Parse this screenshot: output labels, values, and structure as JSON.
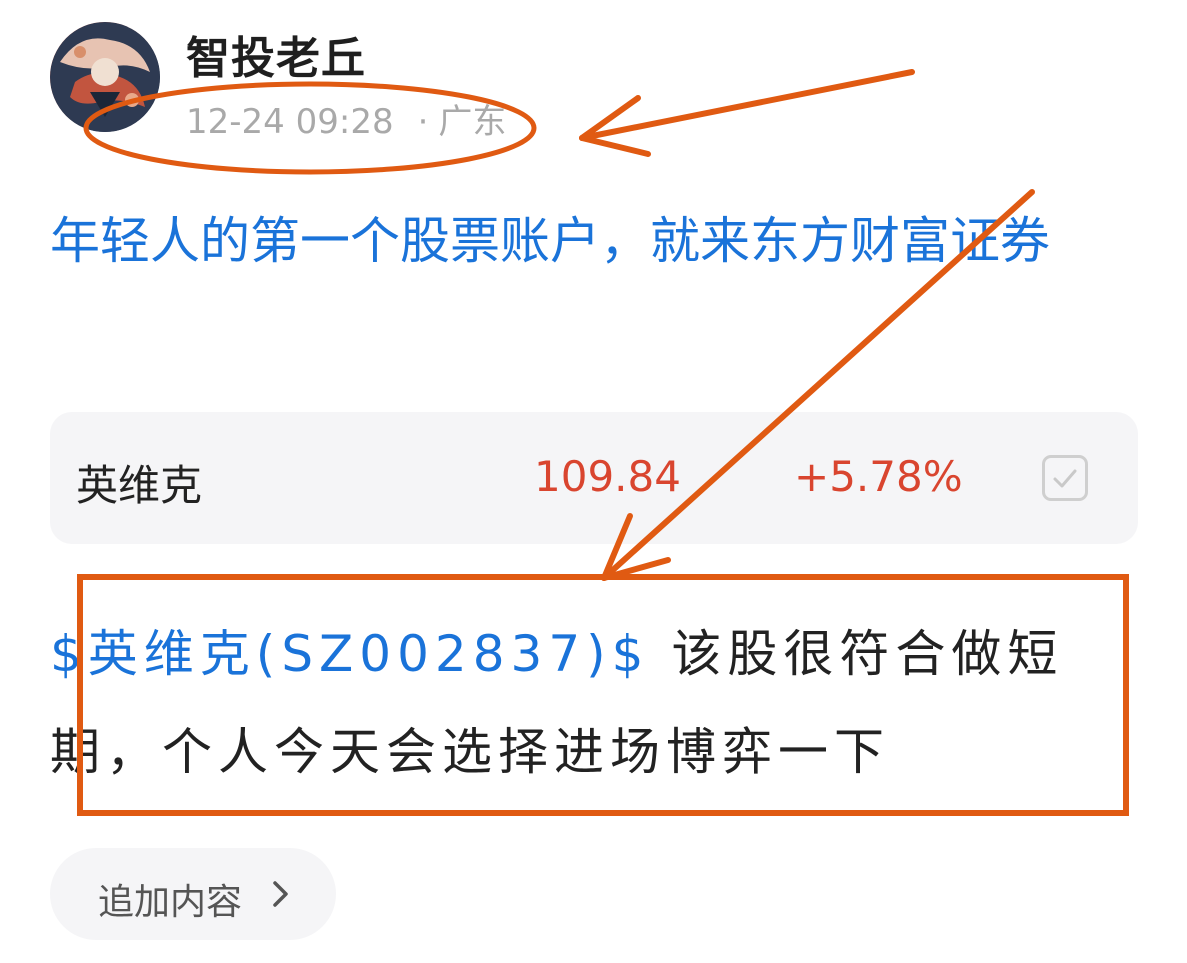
{
  "author": {
    "name": "智投老丘",
    "time": "12-24 09:28",
    "separator": "·",
    "location": "广东"
  },
  "promo": {
    "text": "年轻人的第一个股票账户，就来东方财富证券"
  },
  "stock_card": {
    "name": "英维克",
    "price": "109.84",
    "change": "+5.78%"
  },
  "post": {
    "ticker": "$英维克(SZ002837)$",
    "body": " 该股很符合做短期，个人今天会选择进场博弈一下"
  },
  "actions": {
    "add_content": "追加内容"
  },
  "colors": {
    "link_blue": "#1a73d9",
    "price_red": "#d9452f",
    "annotation_orange": "#e05a12",
    "card_bg": "#f5f5f7"
  },
  "icons": {
    "checkbox": "checkbox-icon",
    "chevron": "chevron-right-icon"
  }
}
